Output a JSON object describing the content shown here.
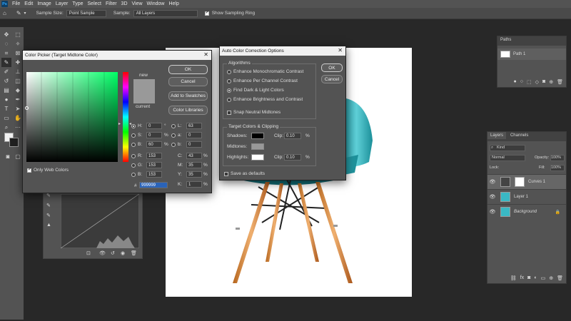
{
  "menubar": {
    "logo": "Ps",
    "items": [
      "File",
      "Edit",
      "Image",
      "Layer",
      "Type",
      "Select",
      "Filter",
      "3D",
      "View",
      "Window",
      "Help"
    ]
  },
  "options": {
    "sample_size_label": "Sample Size:",
    "sample_size_value": "Point Sample",
    "sample_label": "Sample:",
    "sample_value": "All Layers",
    "show_ring_label": "Show Sampling Ring"
  },
  "color_picker": {
    "title": "Color Picker (Target Midtone Color)",
    "ok": "OK",
    "cancel": "Cancel",
    "add_to_swatches": "Add to Swatches",
    "color_libraries": "Color Libraries",
    "new_label": "new",
    "current_label": "current",
    "only_web_colors": "Only Web Colors",
    "h_label": "H:",
    "h_val": "0",
    "h_unit": "°",
    "s_label": "S:",
    "s_val": "0",
    "s_unit": "%",
    "b_label": "B:",
    "b_val": "60",
    "b_unit": "%",
    "r_label": "R:",
    "r_val": "153",
    "g_label": "G:",
    "g_val": "153",
    "bl_label": "B:",
    "bl_val": "153",
    "l_label": "L:",
    "l_val": "63",
    "a_label": "a:",
    "a_val": "0",
    "lb_label": "b:",
    "lb_val": "0",
    "c_label": "C:",
    "c_val": "43",
    "c_unit": "%",
    "m_label": "M:",
    "m_val": "35",
    "m_unit": "%",
    "y_label": "Y:",
    "y_val": "35",
    "y_unit": "%",
    "k_label": "K:",
    "k_val": "1",
    "k_unit": "%",
    "hex_label": "#",
    "hex_val": "999999",
    "new_color": "#999999",
    "current_color": "#999999"
  },
  "auto_color": {
    "title": "Auto Color Correction Options",
    "algorithms_label": "Algorithms",
    "opt1": "Enhance Monochromatic Contrast",
    "opt2": "Enhance Per Channel Contrast",
    "opt3": "Find Dark & Light Colors",
    "opt4": "Enhance Brightness and Contrast",
    "snap": "Snap Neutral Midtones",
    "target_label": "Target Colors & Clipping",
    "shadows": "Shadows:",
    "midtones": "Midtones:",
    "highlights": "Highlights:",
    "clip1_label": "Clip:",
    "clip1_val": "0.10",
    "clip1_unit": "%",
    "clip2_label": "Clip:",
    "clip2_val": "0.10",
    "clip2_unit": "%",
    "save_defaults": "Save as defaults",
    "ok": "OK",
    "cancel": "Cancel"
  },
  "paths_panel": {
    "tab": "Paths",
    "path_name": "Path 1"
  },
  "layers_panel": {
    "tab_layers": "Layers",
    "tab_channels": "Channels",
    "kind": "Kind",
    "mode": "Normal",
    "opacity_label": "Opacity:",
    "opacity_val": "100%",
    "lock_label": "Lock:",
    "fill_label": "Fill:",
    "fill_val": "100%",
    "layers": [
      "Curves 1",
      "Layer 1",
      "Background"
    ]
  }
}
